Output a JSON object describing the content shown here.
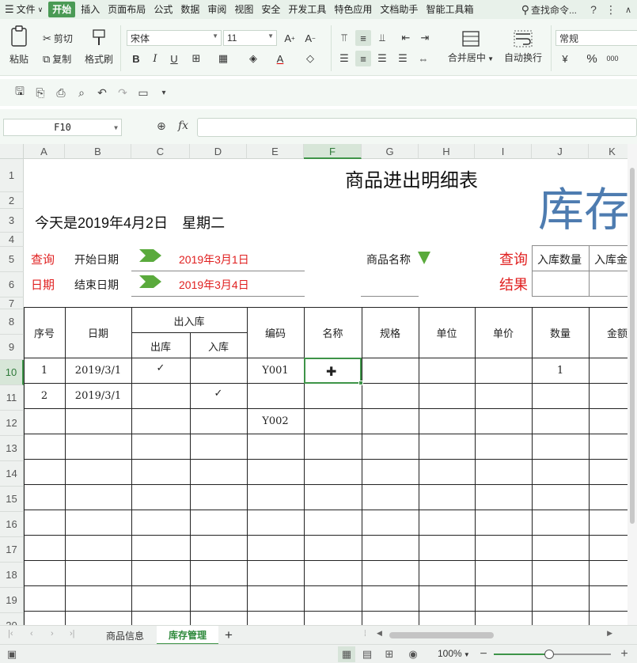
{
  "menubar": {
    "file_label": "文件",
    "tabs": [
      "开始",
      "插入",
      "页面布局",
      "公式",
      "数据",
      "审阅",
      "视图",
      "安全",
      "开发工具",
      "特色应用",
      "文档助手",
      "智能工具箱"
    ],
    "active_tab": "开始",
    "search_label": "查找命令..."
  },
  "ribbon": {
    "paste_label": "粘贴",
    "cut_label": "剪切",
    "copy_label": "复制",
    "format_painter_label": "格式刷",
    "font_name": "宋体",
    "font_size": "11",
    "merge_center_label": "合并居中",
    "wrap_text_label": "自动换行",
    "number_format": "常规"
  },
  "formula_bar": {
    "name_box": "F10",
    "fx_label": "fx",
    "formula": ""
  },
  "columns": [
    "A",
    "B",
    "C",
    "D",
    "E",
    "F",
    "G",
    "H",
    "I",
    "J",
    "K"
  ],
  "selected_column": "F",
  "rows": [
    "1",
    "2",
    "3",
    "4",
    "5",
    "6",
    "7",
    "8",
    "9",
    "10",
    "11",
    "12",
    "13",
    "14",
    "15",
    "16",
    "17",
    "18",
    "19",
    "20"
  ],
  "selected_row": "10",
  "sheet": {
    "title": "商品进出明细表",
    "watermark": "库存",
    "date_line": "今天是2019年4月2日　星期二",
    "query_label": "查询",
    "date_label": "日期",
    "start_date_label": "开始日期",
    "end_date_label": "结束日期",
    "start_date": "2019年3月1日",
    "end_date": "2019年3月4日",
    "product_name_label": "商品名称",
    "query2_label": "查询",
    "result_label": "结果",
    "in_qty_label": "入库数量",
    "in_amount_label": "入库金",
    "headers": {
      "no": "序号",
      "date": "日期",
      "inout": "出入库",
      "out": "出库",
      "in": "入库",
      "code": "编码",
      "name": "名称",
      "spec": "规格",
      "unit": "单位",
      "price": "单价",
      "qty": "数量",
      "amount": "金额"
    },
    "records": [
      {
        "no": "1",
        "date": "2019/3/1",
        "out": "✓",
        "in": "",
        "code": "Y001",
        "qty": "1"
      },
      {
        "no": "2",
        "date": "2019/3/1",
        "out": "",
        "in": "✓",
        "code": "",
        "qty": ""
      },
      {
        "no": "",
        "date": "",
        "out": "",
        "in": "",
        "code": "Y002",
        "qty": ""
      }
    ]
  },
  "tabs": {
    "sheets": [
      "商品信息",
      "库存管理"
    ],
    "active_sheet": "库存管理",
    "add_label": "+"
  },
  "statusbar": {
    "zoom": "100%",
    "zoom_level": 0.47
  },
  "colors": {
    "accent": "#3e9448",
    "red_text": "#e02020",
    "arrow_green": "#5aaa3c",
    "watermark": "#3b6ea8"
  }
}
